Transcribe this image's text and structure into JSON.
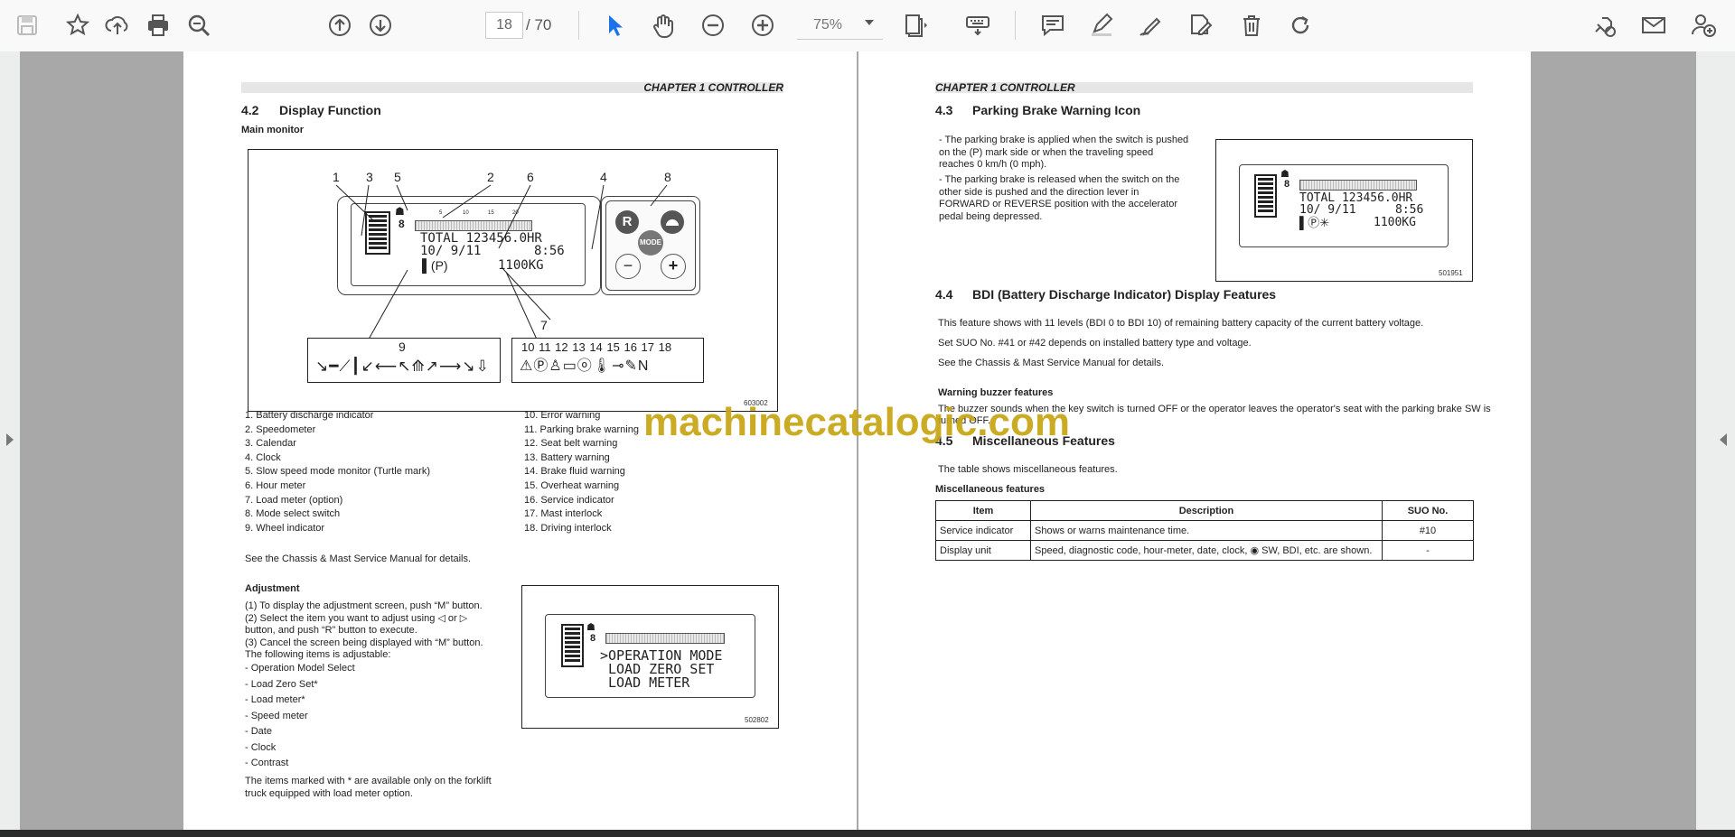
{
  "toolbar": {
    "icons": [
      "save-icon",
      "bookmark-star-icon",
      "upload-icon",
      "print-icon",
      "zoom-search-icon",
      "page-up-icon",
      "page-down-icon",
      "select-cursor-icon",
      "hand-pan-icon",
      "zoom-out-icon",
      "zoom-in-icon",
      "fit-page-icon",
      "keyboard-tool-icon",
      "comment-icon",
      "highlight-pen-icon",
      "draw-sign-icon",
      "edit-fill-icon",
      "delete-icon",
      "rotate-icon",
      "share-link-icon",
      "email-icon",
      "add-user-icon"
    ],
    "current_page": "18",
    "total_pages": "70",
    "page_separator": "/",
    "zoom": "75%",
    "accent": "#1a73e8"
  },
  "left_page": {
    "chapter": "CHAPTER 1 CONTROLLER",
    "section_num": "4.2",
    "section_title": "Display Function",
    "subheading": "Main monitor",
    "figure_callouts": {
      "n1": "1",
      "n2": "2",
      "n3": "3",
      "n4": "4",
      "n5": "5",
      "n6": "6",
      "n7": "7",
      "n8": "8",
      "n9": "9"
    },
    "lcd_total": "TOTAL 123456.0HR",
    "lcd_date": "10/ 9/11",
    "lcd_time": "8:56",
    "lcd_load": "1100KG",
    "lcd_speed_ticks": [
      "5",
      "10",
      "15",
      "20"
    ],
    "mode_buttons": {
      "r": "R",
      "mode": "MODE",
      "minus": "−",
      "plus": "+"
    },
    "icon_row_numbers": "10 11 12 13 14 15 16 17 18",
    "figure_id": "603002",
    "list_left": [
      "1.  Battery discharge indicator",
      "2.  Speedometer",
      "3.  Calendar",
      "4.  Clock",
      "5.  Slow speed mode monitor (Turtle mark)",
      "6.  Hour meter",
      "7.  Load meter (option)",
      "8.  Mode select switch",
      "9.  Wheel indicator"
    ],
    "list_right": [
      "10.  Error warning",
      "11.  Parking brake warning",
      "12.  Seat belt warning",
      "13.  Battery warning",
      "14.  Brake fluid warning",
      "15.  Overheat warning",
      "16.  Service indicator",
      "17.  Mast interlock",
      "18.  Driving interlock"
    ],
    "see_manual": "See the Chassis & Mast Service Manual for details.",
    "adjustment_title": "Adjustment",
    "adjustment_lines": [
      "(1)  To display the adjustment screen, push “M” button.",
      "(2)  Select the item you want to adjust using ◁ or ▷",
      "       button, and push “R” button to execute.",
      "(3)  Cancel the screen being displayed with “M” button.",
      "       The following items is adjustable:",
      "-      Operation Model Select",
      "-      Load Zero Set*",
      "-      Load meter*",
      "-      Speed meter",
      "-      Date",
      "-      Clock",
      "-      Contrast"
    ],
    "footnote_1": "The items marked with * are available only on the forklift",
    "footnote_2": "truck equipped with load meter option.",
    "adj_menu": [
      ">OPERATION MODE",
      "LOAD ZERO SET",
      "LOAD METER"
    ],
    "adj_figure_id": "502802"
  },
  "right_page": {
    "chapter": "CHAPTER 1 CONTROLLER",
    "s43_num": "4.3",
    "s43_title": "Parking Brake Warning Icon",
    "s43_lines": [
      "-      The parking brake is applied when the switch is pushed",
      "       on the (P) mark side or when the traveling speed",
      "       reaches 0 km/h (0 mph).",
      "-      The parking brake is released when the switch on the",
      "       other side is pushed and the direction lever in",
      "       FORWARD or REVERSE position with the accelerator",
      "       pedal being depressed."
    ],
    "s43_figure_id": "501951",
    "s44_num": "4.4",
    "s44_title": "BDI (Battery Discharge Indicator) Display Features",
    "s44_lines": [
      "This feature shows with 11 levels (BDI 0 to BDI 10) of remaining battery capacity of the current battery voltage.",
      "Set SUO No. #41 or #42 depends on installed battery type and voltage.",
      "See the Chassis & Mast Service Manual for details."
    ],
    "buzzer_title": "Warning buzzer features",
    "buzzer_line1": "The buzzer sounds when the key switch is turned OFF or the operator leaves the operator's seat with the parking brake SW is",
    "buzzer_line2": "turned OFF.",
    "s45_num": "4.5",
    "s45_title": "Miscellaneous Features",
    "s45_intro": "The table shows miscellaneous features.",
    "table_caption": "Miscellaneous features",
    "table_headers": [
      "Item",
      "Description",
      "SUO No."
    ],
    "table_rows": [
      [
        "Service indicator",
        "Shows or warns maintenance time.",
        "#10"
      ],
      [
        "Display unit",
        "Speed, diagnostic code, hour-meter, date, clock, ◉ SW, BDI, etc. are shown.",
        "-"
      ]
    ]
  },
  "watermark": "machinecatalogic.com"
}
